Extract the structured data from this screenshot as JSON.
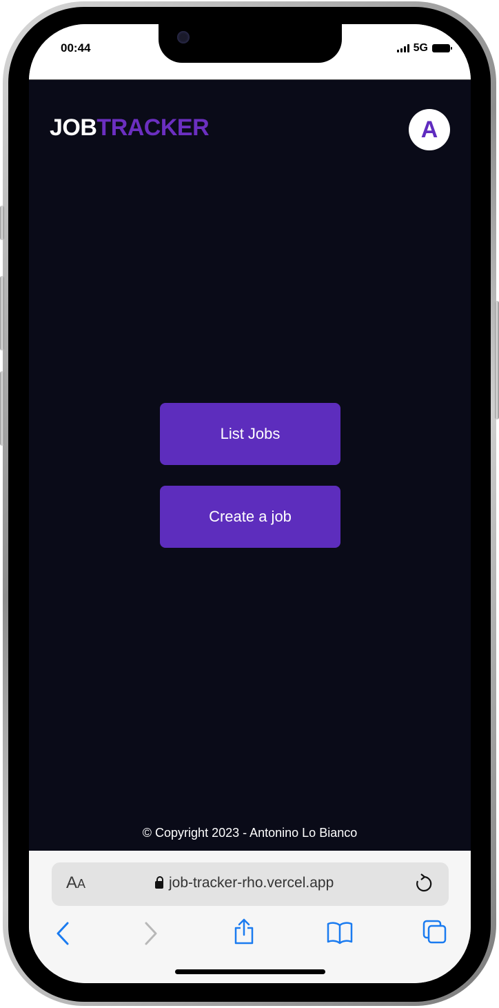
{
  "status_bar": {
    "time": "00:44",
    "network": "5G"
  },
  "app": {
    "logo_part1": "JOB",
    "logo_part2": "TRACKER",
    "avatar_letter": "A",
    "buttons": {
      "list_jobs": "List Jobs",
      "create_job": "Create a job"
    },
    "footer": "© Copyright 2023 - Antonino Lo Bianco",
    "colors": {
      "background": "#0a0b18",
      "accent": "#5d2dbd"
    }
  },
  "browser": {
    "text_size_label_big": "A",
    "text_size_label_small": "A",
    "url": "job-tracker-rho.vercel.app",
    "icons": [
      "lock-icon",
      "reload-icon",
      "back-icon",
      "forward-icon",
      "share-icon",
      "bookmarks-icon",
      "tabs-icon"
    ]
  }
}
